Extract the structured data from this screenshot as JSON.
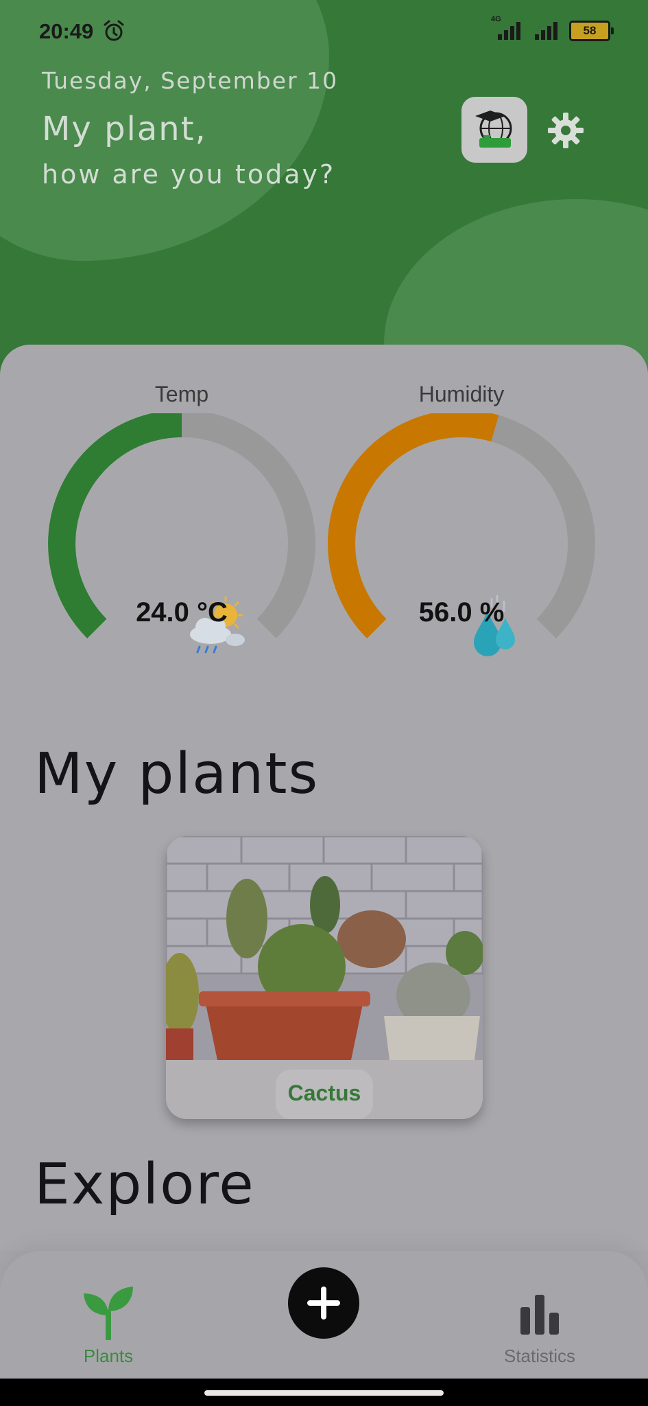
{
  "status_bar": {
    "time": "20:49",
    "network": "4G",
    "battery": "58"
  },
  "header": {
    "date": "Tuesday, September 10",
    "greeting_line1": "My plant,",
    "greeting_line2": "how are you today?"
  },
  "gauges": [
    {
      "label": "Temp",
      "value_text": "24.0 °C",
      "fraction": 0.5,
      "color": "#2e7d32",
      "icon": "weather-sun-cloud-rain-icon"
    },
    {
      "label": "Humidity",
      "value_text": "56.0 %",
      "fraction": 0.56,
      "color": "#c87800",
      "icon": "water-drops-icon"
    }
  ],
  "sections": {
    "my_plants": "My plants",
    "explore": "Explore"
  },
  "plants": [
    {
      "name": "Cactus"
    }
  ],
  "nav": {
    "plants_label": "Plants",
    "statistics_label": "Statistics"
  },
  "colors": {
    "brand_green": "#357838",
    "accent_orange": "#c87800"
  }
}
